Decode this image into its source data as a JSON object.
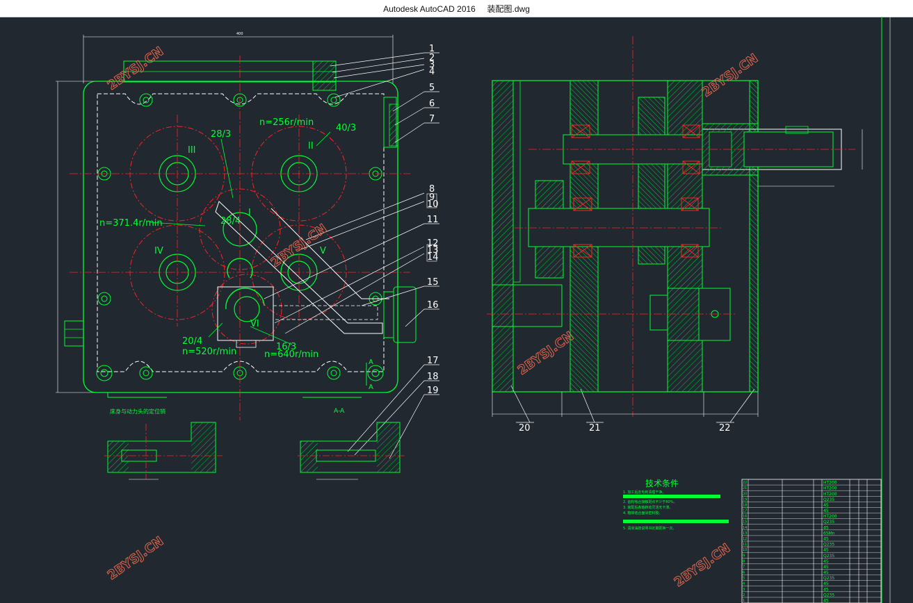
{
  "window": {
    "app": "Autodesk AutoCAD 2016",
    "file": "装配图.dwg"
  },
  "colors": {
    "background": "#212830",
    "outline": "#00ff33",
    "center_line": "#ff2222",
    "leader": "#ffffff",
    "watermark": "#e7664d"
  },
  "watermark": "2BYSJ.CN",
  "part_balloons": [
    "1",
    "2",
    "3",
    "4",
    "5",
    "6",
    "7",
    "8",
    "9",
    "10",
    "11",
    "12",
    "13",
    "14",
    "15",
    "16",
    "17",
    "18",
    "19",
    "20",
    "21",
    "22"
  ],
  "annotations": {
    "speed1": "n=256r/min",
    "speed2": "n=371.4r/min",
    "speed3": "n=520r/min",
    "speed4": "n=640r/min",
    "ratio1": "28/3",
    "ratio2": "40/3",
    "ratio3": "28/4",
    "ratio4": "20/4",
    "ratio5": "16/3",
    "roman": [
      "III",
      "II",
      "I",
      "IV",
      "V",
      "VI"
    ],
    "section_mark": "A",
    "caption_left": "床身与动力头的定位销",
    "caption_section": "A-A"
  },
  "tech_conditions": {
    "title": "技术条件",
    "lines": [
      "1. 加工后去毛刺清理干净。",
      "2. 齿轮啮合接触斑点不少于80%。",
      "3. 装配后各轴转动灵活无卡滞。",
      "4. 箱体结合面涂密封胶。",
      "5. 润滑油按说明书定期更换一次。"
    ]
  },
  "bom": {
    "rows": [
      {
        "no": "22",
        "mat": "HT200"
      },
      {
        "no": "21",
        "mat": "HT200"
      },
      {
        "no": "20",
        "mat": "HT200"
      },
      {
        "no": "19",
        "mat": "Q235"
      },
      {
        "no": "18",
        "mat": "45"
      },
      {
        "no": "17",
        "mat": "45"
      },
      {
        "no": "16",
        "mat": "HT200"
      },
      {
        "no": "15",
        "mat": "Q235"
      },
      {
        "no": "14",
        "mat": "45"
      },
      {
        "no": "13",
        "mat": "65Mn"
      },
      {
        "no": "12",
        "mat": "45"
      },
      {
        "no": "11",
        "mat": "Q235"
      },
      {
        "no": "10",
        "mat": "45"
      },
      {
        "no": "9",
        "mat": "Q235"
      },
      {
        "no": "8",
        "mat": "45"
      },
      {
        "no": "7",
        "mat": "45"
      },
      {
        "no": "6",
        "mat": "45"
      },
      {
        "no": "5",
        "mat": "Q235"
      },
      {
        "no": "4",
        "mat": "45"
      },
      {
        "no": "3",
        "mat": "45"
      },
      {
        "no": "2",
        "mat": "Q235"
      },
      {
        "no": "1",
        "mat": "45"
      }
    ]
  }
}
